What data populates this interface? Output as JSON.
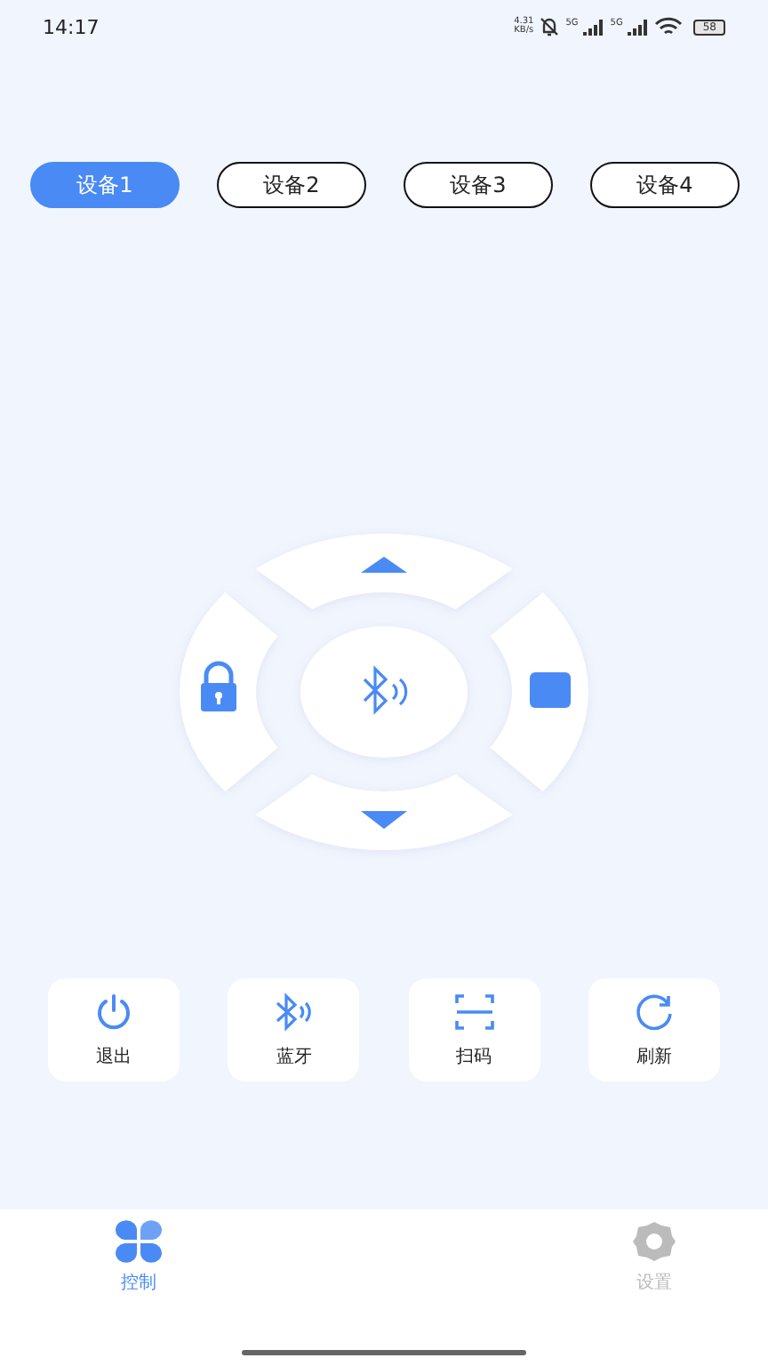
{
  "status_bar": {
    "time": "14:17",
    "speed": "4.31",
    "speed_unit": "KB/s",
    "network_1": "5G",
    "network_2": "5G",
    "battery": "58"
  },
  "devices": [
    {
      "label": "设备1",
      "selected": true
    },
    {
      "label": "设备2",
      "selected": false
    },
    {
      "label": "设备3",
      "selected": false
    },
    {
      "label": "设备4",
      "selected": false
    }
  ],
  "actions": [
    {
      "kind": "power",
      "label": "退出"
    },
    {
      "kind": "bluetooth",
      "label": "蓝牙"
    },
    {
      "kind": "scan",
      "label": "扫码"
    },
    {
      "kind": "refresh",
      "label": "刷新"
    }
  ],
  "nav": [
    {
      "kind": "control",
      "label": "控制",
      "selected": true
    },
    {
      "kind": "settings",
      "label": "设置",
      "selected": false
    }
  ]
}
